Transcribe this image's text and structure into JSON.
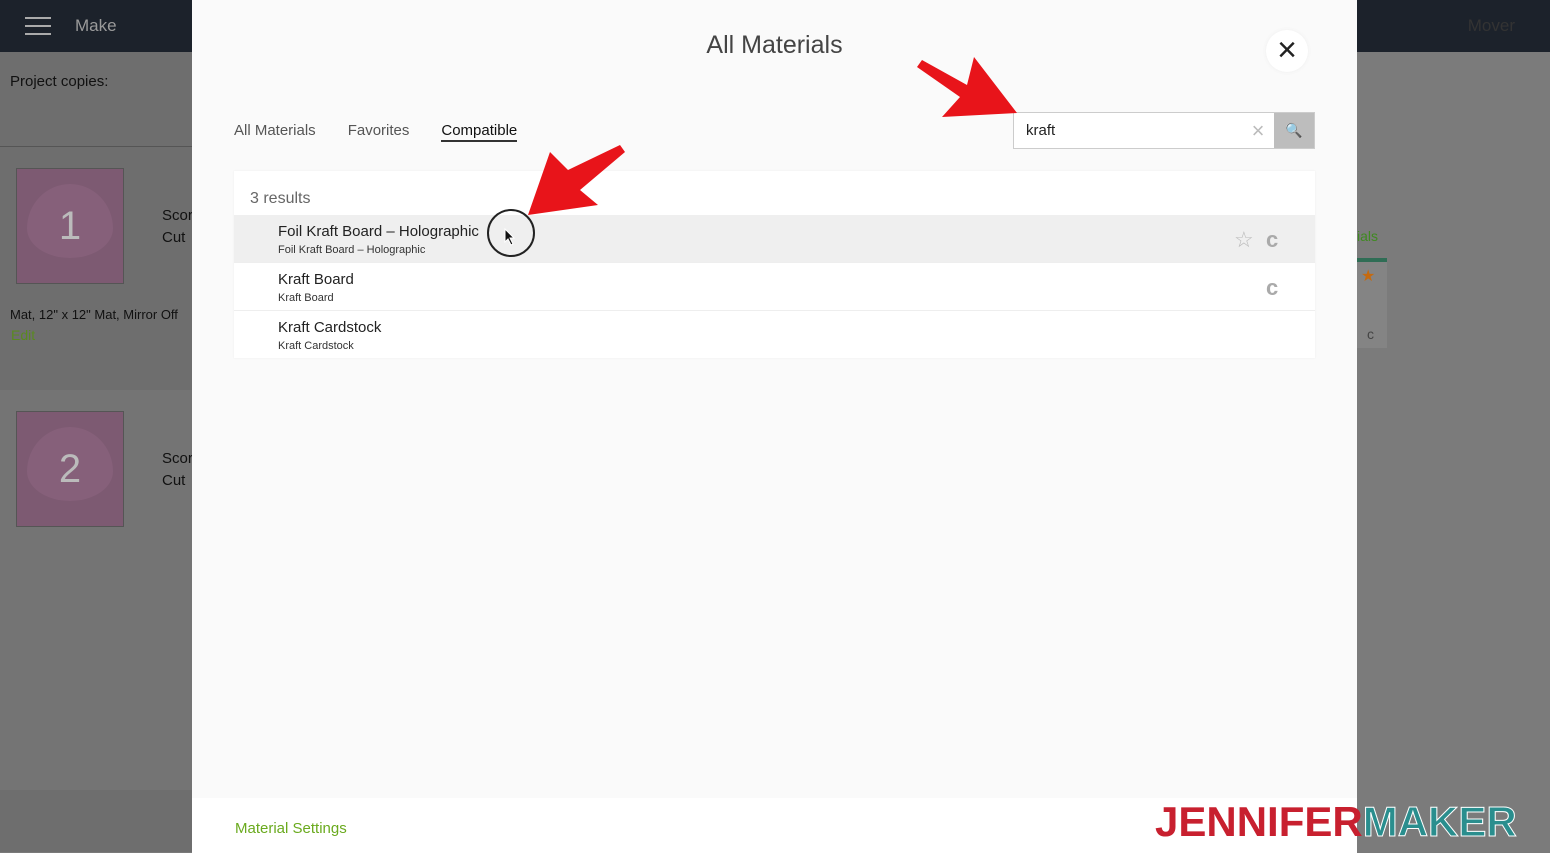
{
  "background": {
    "app_title": "Make",
    "right_top": "Mover",
    "project_copies_label": "Project copies:",
    "mats": [
      {
        "number": "1",
        "lines": [
          "Scor",
          "Cut"
        ]
      },
      {
        "number": "2",
        "lines": [
          "Scor",
          "Cut"
        ]
      }
    ],
    "mat_info": "Mat, 12\" x 12\" Mat, Mirror Off",
    "edit_link": "Edit",
    "right_label": "ials"
  },
  "modal": {
    "title": "All Materials",
    "close_icon": "close-icon",
    "tabs": [
      {
        "label": "All Materials",
        "active": false
      },
      {
        "label": "Favorites",
        "active": false
      },
      {
        "label": "Compatible",
        "active": true
      }
    ],
    "search": {
      "value": "kraft",
      "placeholder": ""
    },
    "results_count": "3 results",
    "results": [
      {
        "name": "Foil Kraft Board  – Holographic",
        "sub": "Foil Kraft Board  – Holographic",
        "favorite": true,
        "compatible": true,
        "highlighted": true
      },
      {
        "name": "Kraft Board",
        "sub": "Kraft Board",
        "favorite": false,
        "compatible": true,
        "highlighted": false
      },
      {
        "name": "Kraft Cardstock",
        "sub": "Kraft Cardstock",
        "favorite": false,
        "compatible": false,
        "highlighted": false
      }
    ],
    "material_settings": "Material Settings"
  },
  "watermark": {
    "part1": "JENNIFER",
    "part2": "MAKER"
  },
  "colors": {
    "accent_green": "#6aaa1e",
    "arrow_red": "#e8141a",
    "logo_red": "#c8202f",
    "logo_teal": "#2a8e8e"
  }
}
